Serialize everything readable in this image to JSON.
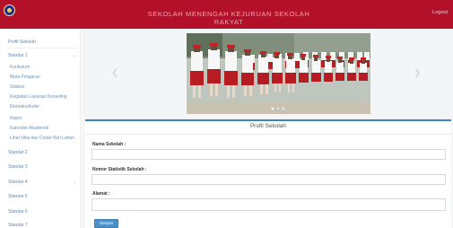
{
  "header": {
    "title": "Sekolah Menengah Kejuruan Sekolah Rakyat",
    "logout_label": "Logout",
    "brand_color": "#b3112a"
  },
  "sidebar": {
    "items": [
      {
        "label": "Profil Sekolah",
        "expandable": false
      },
      {
        "label": "Standar 1",
        "expandable": true
      },
      {
        "label": "Standar 2",
        "expandable": false
      },
      {
        "label": "Standar 3",
        "expandable": false
      },
      {
        "label": "Standar 4",
        "expandable": true
      },
      {
        "label": "Standar 5",
        "expandable": false
      },
      {
        "label": "Standar 6",
        "expandable": false
      },
      {
        "label": "Standar 7",
        "expandable": false
      }
    ],
    "sub_items": [
      "Kurikulum",
      "Mata Pelajaran",
      "Silabus",
      "Kegiatan Layanan Konseling",
      "Ekstrakurikuler",
      "Rapor",
      "Kalender Akademik",
      "Lihat Nilai dan Cetak Hari Lahan"
    ],
    "chevron_icon": "chevron-down-icon"
  },
  "carousel": {
    "image_description": "students-in-uniform",
    "prev_icon": "chevron-left-icon",
    "next_icon": "chevron-right-icon",
    "slides": 3,
    "active_slide": 1
  },
  "form": {
    "title": "Profil Sekolah",
    "fields": [
      {
        "label": "Nama Sekolah :",
        "value": ""
      },
      {
        "label": "Nomor Statistik Sekolah :",
        "value": ""
      },
      {
        "label": "Alamat :",
        "value": ""
      }
    ],
    "submit_label": "Simpan",
    "accent_color": "#3d84b8"
  }
}
